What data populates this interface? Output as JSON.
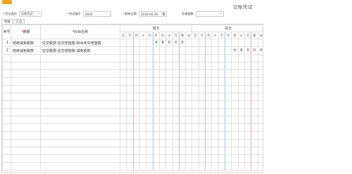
{
  "page": {
    "title": "记账凭证"
  },
  "form": {
    "voucher_type_label": "凭证类别",
    "voucher_type_value": "记账凭证",
    "voucher_no_label": "凭证编号",
    "voucher_no_value": "0004",
    "date_label": "制单日期",
    "date_value": "2018-06-30",
    "attachments_label": "附单据数",
    "attachments_value": ""
  },
  "tabs": [
    "明细",
    "汇总"
  ],
  "table": {
    "headers": {
      "seq": "序号",
      "summary": "摘要",
      "account": "科目名称",
      "debit": "借方",
      "credit": "贷方"
    },
    "digit_headers": [
      "亿",
      "千",
      "百",
      "十",
      "万",
      "千",
      "百",
      "十",
      "元",
      "角",
      "分"
    ],
    "rows": [
      {
        "seq": "1",
        "summary": "结转减免税款",
        "account": "应交税费-应交增值税-转出未交增值税",
        "debit_digits": [
          "",
          "",
          "",
          "",
          "",
          "4",
          "8",
          "0",
          "0",
          "0",
          ""
        ],
        "credit_digits": [
          "",
          "",
          "",
          "",
          "",
          "",
          "",
          "",
          "",
          "",
          ""
        ]
      },
      {
        "seq": "2",
        "summary": "结转减免税款",
        "account": "应交税费-应交增值税-减免税款",
        "debit_digits": [
          "",
          "",
          "",
          "",
          "",
          "",
          "",
          "",
          "",
          "",
          ""
        ],
        "credit_digits": [
          "",
          "",
          "",
          "",
          "",
          "",
          "4",
          "8",
          "0",
          "0",
          "0"
        ]
      }
    ],
    "empty_row_count": 15
  }
}
